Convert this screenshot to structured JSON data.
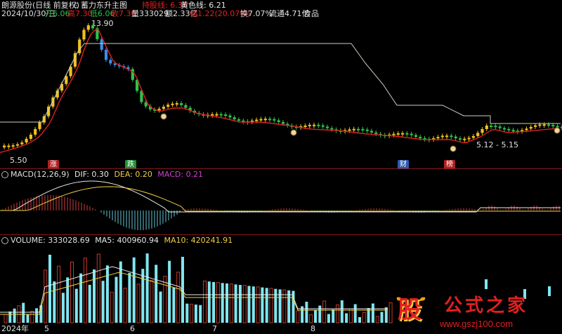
{
  "header": {
    "stock_name": "朗源股份(日线 前复权)",
    "indicator_name": "蓄力东升主图",
    "line1_label": "持股线: 6.36",
    "line2_label": "黄色线: 6.21",
    "date": "2024/10/30/三",
    "open": "开6.06",
    "high": "高7.30",
    "low": "低6.06",
    "close": "收7.30",
    "volume": "量333029",
    "amount": "额2.33亿",
    "change": "幅1.22(20.07%)",
    "turnover": "换7.07%",
    "float_value": "流通4.71亿",
    "sector": "食品"
  },
  "main_chart": {
    "high_label": "13.90",
    "low_label": "5.50",
    "range_label": "5.12 - 5.15",
    "coin_symbol": "$",
    "tags": [
      {
        "text": "涨",
        "color": "#e03030"
      },
      {
        "text": "跌",
        "color": "#2ec24a"
      },
      {
        "text": "财",
        "color": "#3a72d8"
      },
      {
        "text": "榜",
        "color": "#e03030"
      }
    ]
  },
  "macd": {
    "title": "MACD(12,26,9)",
    "dif": "DIF: 0.30",
    "dea": "DEA: 0.20",
    "macd": "MACD: 0.21"
  },
  "volume_pane": {
    "title": "VOLUME: 333028.69",
    "ma5": "MA5: 400960.94",
    "ma10": "MA10: 420241.91"
  },
  "x_axis": {
    "labels": [
      "2024年",
      "5",
      "6",
      "7",
      "8"
    ]
  },
  "watermark": {
    "char": "股",
    "title": "公式之家",
    "url": "www.gszj100.com"
  },
  "colors": {
    "up_candle": "#f0c020",
    "down_candle": "#2ec24a",
    "down_candle_alt": "#3a8ee8",
    "ma_red": "#e02020",
    "line_white": "#d0d0c0",
    "vol_red": "#c03a2a",
    "vol_cyan": "#7fe6f0"
  }
}
